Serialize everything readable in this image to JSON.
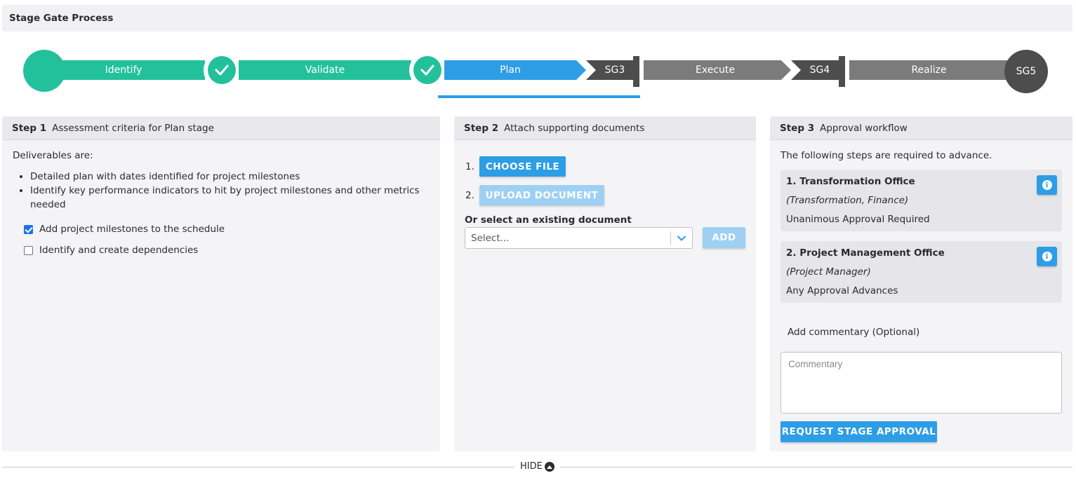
{
  "header": {
    "title": "Stage Gate Process"
  },
  "stages": {
    "identify": "Identify",
    "validate": "Validate",
    "plan": "Plan",
    "sg3": "SG3",
    "execute": "Execute",
    "sg4": "SG4",
    "realize": "Realize",
    "sg5": "SG5"
  },
  "colors": {
    "completed": "#23c19b",
    "active": "#2d9de6",
    "pending": "#7b7b7b",
    "gate": "#4d4d4d"
  },
  "step1": {
    "step_label": "Step 1",
    "title": "Assessment criteria for Plan stage",
    "intro": "Deliverables are:",
    "deliverables": [
      "Detailed plan with dates identified for project milestones",
      "Identify key performance indicators to hit by project milestones and other metrics needed"
    ],
    "checklist": [
      {
        "label": "Add project milestones to the schedule",
        "checked": true
      },
      {
        "label": "Identify and create dependencies",
        "checked": false
      }
    ]
  },
  "step2": {
    "step_label": "Step 2",
    "title": "Attach supporting documents",
    "num1": "1.",
    "num2": "2.",
    "choose_file": "CHOOSE FILE",
    "upload_document": "UPLOAD DOCUMENT",
    "existing_label": "Or select an existing document",
    "select_placeholder": "Select...",
    "add": "ADD"
  },
  "step3": {
    "step_label": "Step 3",
    "title": "Approval workflow",
    "intro": "The following steps are required to advance.",
    "workflow": [
      {
        "title": "1. Transformation Office",
        "subtitle": "(Transformation, Finance)",
        "rule": "Unanimous Approval Required"
      },
      {
        "title": "2. Project Management Office",
        "subtitle": "(Project Manager)",
        "rule": "Any Approval Advances"
      }
    ],
    "commentary_label": "Add commentary (Optional)",
    "commentary_placeholder": "Commentary",
    "request_button": "REQUEST STAGE APPROVAL"
  },
  "footer": {
    "hide_label": "HIDE"
  }
}
